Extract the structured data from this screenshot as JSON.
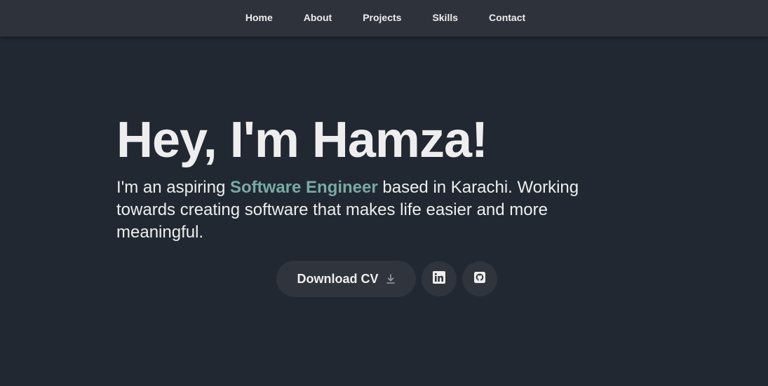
{
  "nav": {
    "items": [
      {
        "label": "Home"
      },
      {
        "label": "About"
      },
      {
        "label": "Projects"
      },
      {
        "label": "Skills"
      },
      {
        "label": "Contact"
      }
    ]
  },
  "hero": {
    "title": "Hey, I'm Hamza!",
    "desc_before": "I'm an aspiring ",
    "desc_highlight": "Software Engineer",
    "desc_after": " based in Karachi. Working towards creating software that makes life easier and more meaningful."
  },
  "actions": {
    "download_label": "Download CV",
    "download_icon": "download-icon",
    "linkedin_icon": "linkedin-icon",
    "github_icon": "github-icon"
  },
  "colors": {
    "background": "#222831",
    "navbar": "#2e323a",
    "text": "#eeeeee",
    "accent": "#76aba3",
    "button": "#30343c"
  }
}
